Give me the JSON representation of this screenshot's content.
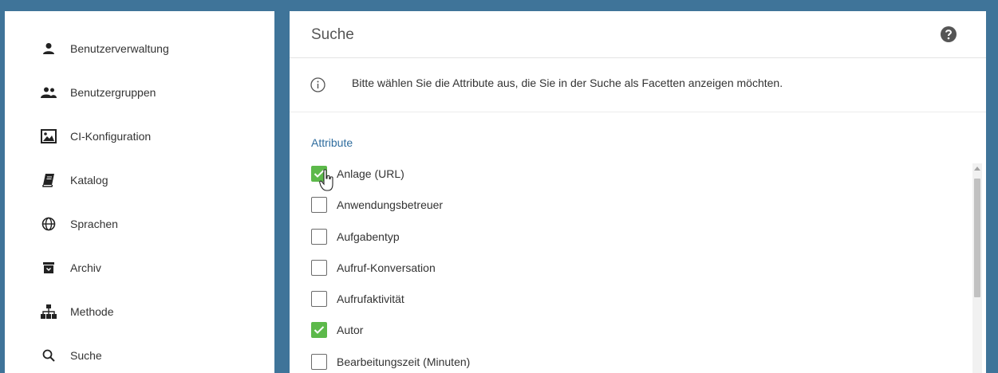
{
  "sidebar": {
    "items": [
      {
        "label": "Benutzerverwaltung",
        "icon": "person-icon"
      },
      {
        "label": "Benutzergruppen",
        "icon": "people-icon"
      },
      {
        "label": "CI-Konfiguration",
        "icon": "image-icon"
      },
      {
        "label": "Katalog",
        "icon": "book-icon"
      },
      {
        "label": "Sprachen",
        "icon": "globe-icon"
      },
      {
        "label": "Archiv",
        "icon": "archive-icon"
      },
      {
        "label": "Methode",
        "icon": "sitemap-icon"
      },
      {
        "label": "Suche",
        "icon": "search-icon"
      }
    ]
  },
  "main": {
    "title": "Suche",
    "info_text": "Bitte wählen Sie die Attribute aus, die Sie in der Suche als Facetten anzeigen möchten.",
    "section_label": "Attribute",
    "attributes": [
      {
        "label": "Anlage (URL)",
        "checked": true
      },
      {
        "label": "Anwendungsbetreuer",
        "checked": false
      },
      {
        "label": "Aufgabentyp",
        "checked": false
      },
      {
        "label": "Aufruf-Konversation",
        "checked": false
      },
      {
        "label": "Aufrufaktivität",
        "checked": false
      },
      {
        "label": "Autor",
        "checked": true
      },
      {
        "label": "Bearbeitungszeit (Minuten)",
        "checked": false
      }
    ]
  },
  "colors": {
    "background": "#3f7499",
    "checkbox_checked": "#5cb94a",
    "section_label": "#2e6c9e"
  }
}
